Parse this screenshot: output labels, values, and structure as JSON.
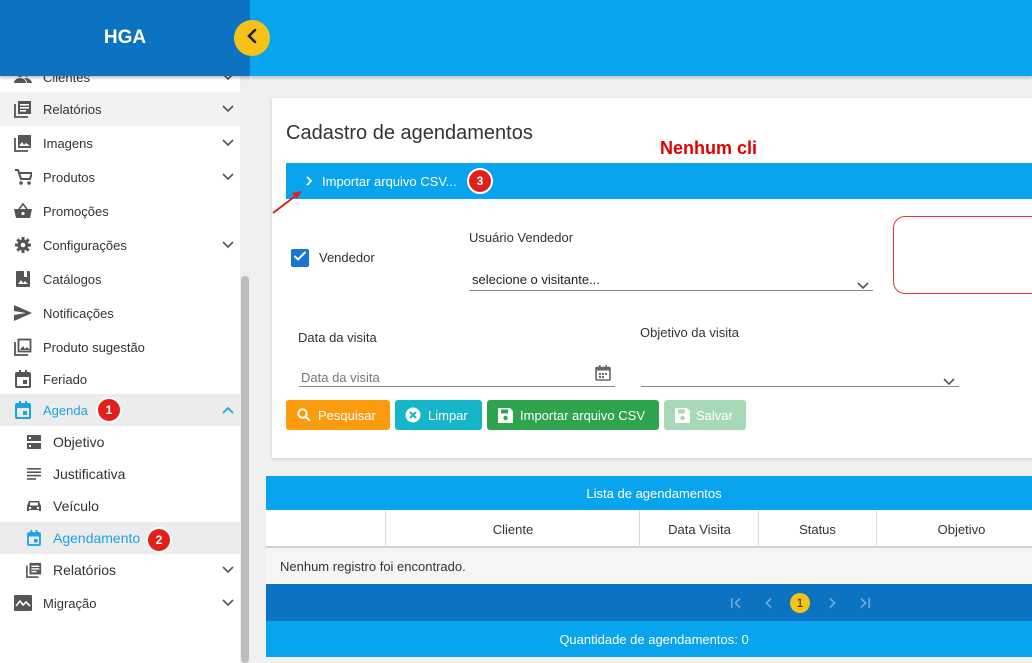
{
  "app": {
    "brand": "HGA"
  },
  "colors": {
    "primary": "#08a4ee",
    "dark_primary": "#0b73c2",
    "accent": "#f5c21a",
    "badge": "#e0201a"
  },
  "sidebar": {
    "items": [
      {
        "label": "Clientes",
        "icon": "people-icon"
      },
      {
        "label": "Relatórios",
        "icon": "report-icon"
      },
      {
        "label": "Imagens",
        "icon": "image-icon"
      },
      {
        "label": "Produtos",
        "icon": "cart-icon"
      },
      {
        "label": "Promoções",
        "icon": "basket-icon"
      },
      {
        "label": "Configurações",
        "icon": "gear-icon"
      },
      {
        "label": "Catálogos",
        "icon": "catalog-icon"
      },
      {
        "label": "Notificações",
        "icon": "send-icon"
      },
      {
        "label": "Produto sugestão",
        "icon": "gallery-icon"
      },
      {
        "label": "Feriado",
        "icon": "calendar-icon"
      },
      {
        "label": "Agenda",
        "icon": "calendar-icon"
      }
    ],
    "agenda_sub": [
      {
        "label": "Objetivo",
        "icon": "storage-icon"
      },
      {
        "label": "Justificativa",
        "icon": "lines-icon"
      },
      {
        "label": "Veículo",
        "icon": "car-icon"
      },
      {
        "label": "Agendamento",
        "icon": "calendar-icon"
      },
      {
        "label": "Relatórios",
        "icon": "report-icon"
      }
    ],
    "migracao": {
      "label": "Migração",
      "icon": "chart-icon"
    }
  },
  "badges": {
    "b1": "1",
    "b2": "2",
    "b3": "3"
  },
  "form": {
    "title": "Cadastro de agendamentos",
    "import_toggle": "Importar arquivo CSV...",
    "vendedor_checkbox": "Vendedor",
    "vendedor_checked": true,
    "usuario_label": "Usuário Vendedor",
    "usuario_value": "selecione o visitante...",
    "warning_text": "Nenhum cli",
    "data_label": "Data da visita",
    "data_placeholder": "Data da visita",
    "objetivo_label": "Objetivo da visita",
    "objetivo_value": ""
  },
  "buttons": {
    "pesquisar": "Pesquisar",
    "limpar": "Limpar",
    "importar": "Importar arquivo CSV",
    "salvar": "Salvar"
  },
  "table": {
    "title": "Lista de agendamentos",
    "columns": [
      "",
      "Cliente",
      "Data Visita",
      "Status",
      "Objetivo"
    ],
    "empty_message": "Nenhum registro foi encontrado.",
    "current_page": "1",
    "footer": "Quantidade de agendamentos: 0"
  }
}
